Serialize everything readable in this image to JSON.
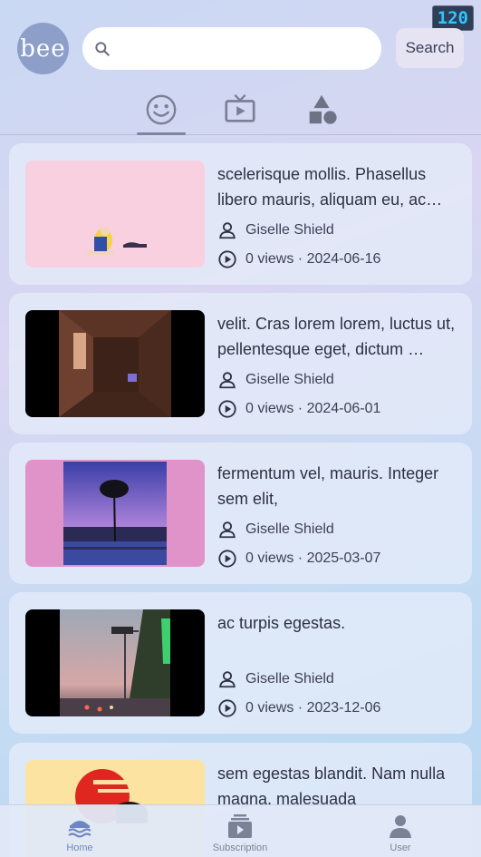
{
  "status": {
    "fps": "120"
  },
  "header": {
    "logo_text": "bee",
    "search_placeholder": "",
    "search_value": "",
    "search_button": "Search"
  },
  "tabs": [
    {
      "icon": "smiley-icon",
      "active": true
    },
    {
      "icon": "tv-icon",
      "active": false
    },
    {
      "icon": "shapes-icon",
      "active": false
    }
  ],
  "videos": [
    {
      "title": "scelerisque mollis. Phasellus libero mauris, aliquam eu, ac…",
      "author": "Giselle Shield",
      "stats": "0 views · 2024-06-16"
    },
    {
      "title": "velit. Cras lorem lorem, luctus ut, pellentesque eget, dictum …",
      "author": "Giselle Shield",
      "stats": "0 views · 2024-06-01"
    },
    {
      "title": "fermentum vel, mauris. Integer sem elit,",
      "author": "Giselle Shield",
      "stats": "0 views · 2025-03-07"
    },
    {
      "title": "ac turpis egestas.",
      "author": "Giselle Shield",
      "stats": "0 views · 2023-12-06"
    },
    {
      "title": "sem egestas blandit. Nam nulla magna, malesuada",
      "author": "",
      "stats": ""
    }
  ],
  "nav": {
    "home": "Home",
    "subscription": "Subscription",
    "user": "User"
  },
  "colors": {
    "accent": "#6e86c4",
    "avatar": "#8d9fc9"
  }
}
